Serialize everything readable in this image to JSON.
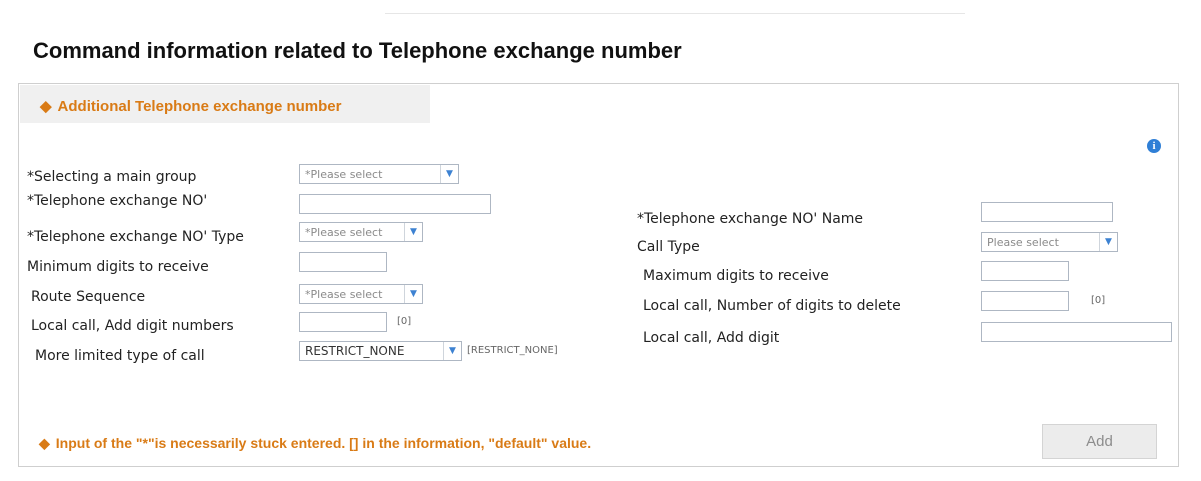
{
  "page": {
    "title": "Command information related to Telephone exchange number"
  },
  "section": {
    "title": "Additional Telephone exchange number"
  },
  "info_icon": {
    "glyph": "i"
  },
  "form_left": {
    "main_group": {
      "label": "*Selecting a main group",
      "value": "*Please select"
    },
    "exchange_no": {
      "label": "*Telephone exchange NO'",
      "value": ""
    },
    "exchange_type": {
      "label": "*Telephone exchange NO' Type",
      "value": "*Please select"
    },
    "min_digits": {
      "label": "Minimum digits to receive",
      "value": ""
    },
    "route_sequence": {
      "label": "Route Sequence",
      "value": "*Please select"
    },
    "add_digit_numbers": {
      "label": "Local call, Add digit numbers",
      "value": "",
      "default": "[0]"
    },
    "limited_call_type": {
      "label": "More limited type of call",
      "value": "RESTRICT_NONE",
      "default": "[RESTRICT_NONE]"
    }
  },
  "form_right": {
    "exchange_name": {
      "label": "*Telephone exchange NO' Name",
      "value": ""
    },
    "call_type": {
      "label": "Call Type",
      "value": "Please select"
    },
    "max_digits": {
      "label": "Maximum digits to receive",
      "value": ""
    },
    "digits_to_delete": {
      "label": "Local call, Number of digits to delete",
      "value": "",
      "default": "[0]"
    },
    "add_digit": {
      "label": "Local call, Add digit",
      "value": ""
    }
  },
  "footer": {
    "note": "Input of the \"*\"is necessarily stuck entered. [] in the information, \"default\" value.",
    "add_label": "Add"
  },
  "colors": {
    "accent": "#d97b16",
    "info": "#2f7fd6",
    "border": "#aeb7c3"
  }
}
